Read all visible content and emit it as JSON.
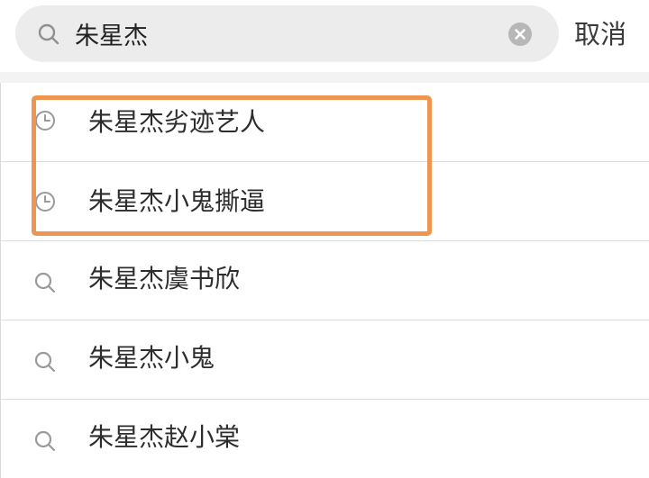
{
  "search": {
    "value": "朱星杰",
    "icon": "search-icon",
    "clear_icon": "clear-icon"
  },
  "cancel_label": "取消",
  "history": [
    {
      "label": "朱星杰劣迹艺人",
      "icon": "history-clock-icon"
    },
    {
      "label": "朱星杰小鬼撕逼",
      "icon": "history-clock-icon"
    }
  ],
  "suggestions": [
    {
      "label": "朱星杰虞书欣",
      "icon": "search-icon"
    },
    {
      "label": "朱星杰小鬼",
      "icon": "search-icon"
    },
    {
      "label": "朱星杰赵小棠",
      "icon": "search-icon"
    }
  ],
  "colors": {
    "highlight": "#ef9550",
    "search_bg": "#ececec",
    "divider": "#dedede"
  }
}
